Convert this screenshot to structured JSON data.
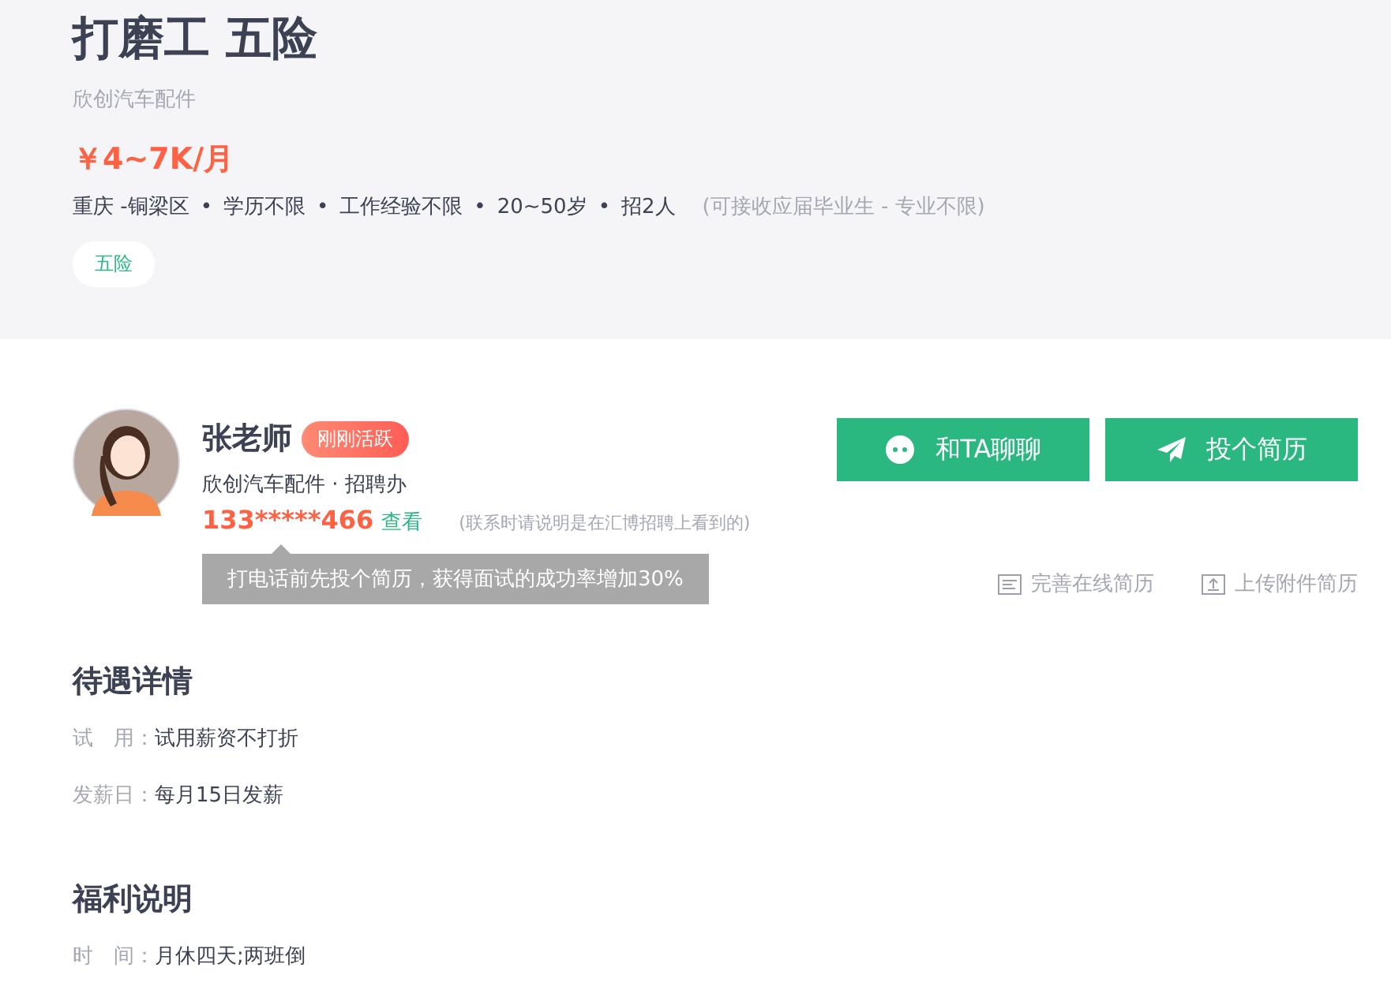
{
  "job": {
    "title": "打磨工 五险",
    "company": "欣创汽车配件",
    "salary": "￥4~7K/月",
    "meta": [
      "重庆 -铜梁区",
      "学历不限",
      "工作经验不限",
      "20~50岁",
      "招2人"
    ],
    "separator": "•",
    "note": "(可接收应届毕业生 - 专业不限)",
    "tags": [
      "五险"
    ]
  },
  "recruiter": {
    "name": "张老师",
    "badge": "刚刚活跃",
    "org": "欣创汽车配件 · 招聘办",
    "phone": "133*****466",
    "view_link": "查看",
    "hint": "(联系时请说明是在汇博招聘上看到的)",
    "tooltip": "打电话前先投个简历，获得面试的成功率增加30%"
  },
  "actions": [
    {
      "kind": "chat",
      "label": "和TA聊聊"
    },
    {
      "kind": "send",
      "label": "投个简历"
    }
  ],
  "resume_links": [
    {
      "kind": "doc",
      "label": "完善在线简历"
    },
    {
      "kind": "upload",
      "label": "上传附件简历"
    }
  ],
  "sections": [
    {
      "title": "待遇详情",
      "rows": [
        {
          "label": "试　用：",
          "value": "试用薪资不打折"
        },
        {
          "label": "发薪日：",
          "value": "每月15日发薪"
        }
      ]
    },
    {
      "title": "福利说明",
      "rows": [
        {
          "label": "时　间：",
          "value": "月休四天;两班倒"
        }
      ]
    }
  ]
}
